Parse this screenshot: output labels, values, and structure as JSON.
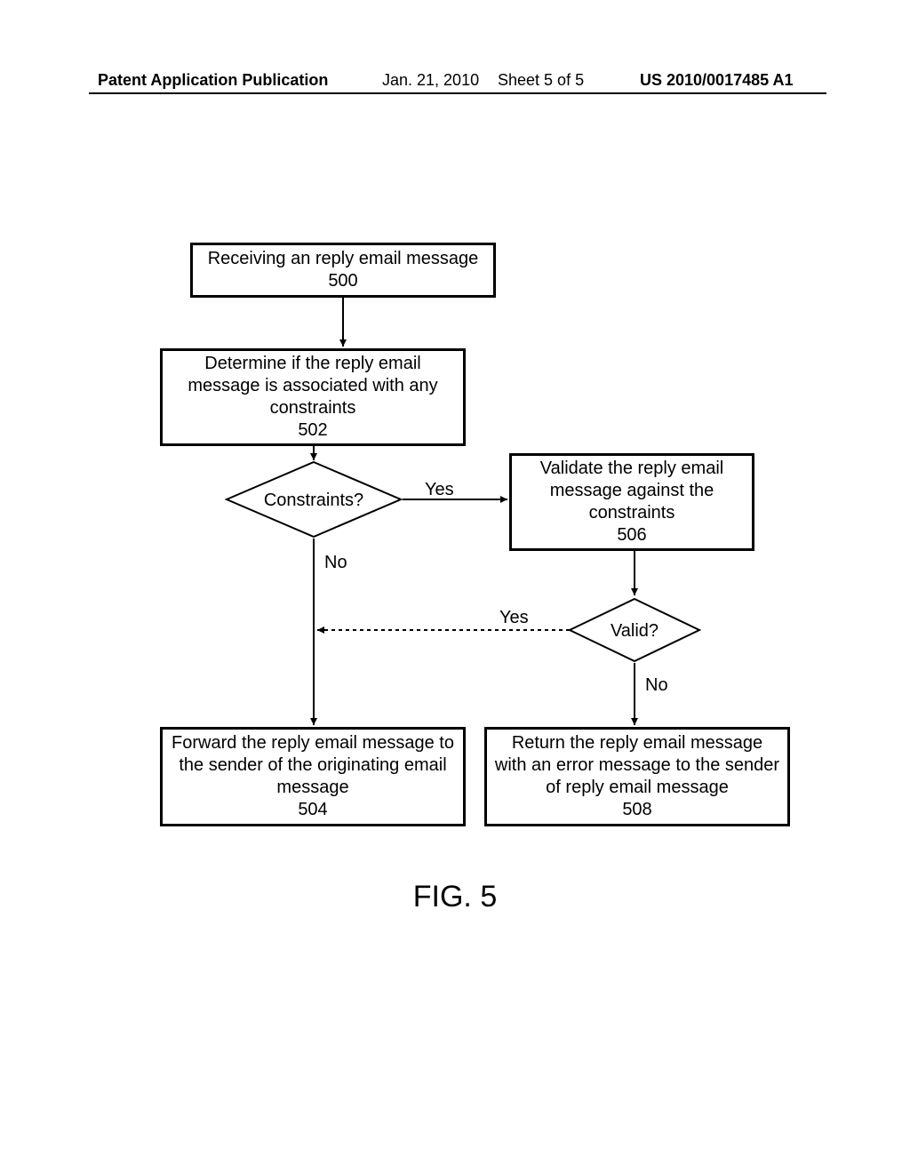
{
  "header": {
    "left": "Patent Application Publication",
    "date": "Jan. 21, 2010",
    "sheet": "Sheet 5 of 5",
    "pub": "US 2010/0017485 A1"
  },
  "boxes": {
    "b500": {
      "text": "Receiving an reply email message",
      "num": "500"
    },
    "b502": {
      "text": "Determine if the reply email message is associated with any constraints",
      "num": "502"
    },
    "b506": {
      "text": "Validate the reply email message against the constraints",
      "num": "506"
    },
    "b504": {
      "text": "Forward the reply email message to the sender of the originating email message",
      "num": "504"
    },
    "b508": {
      "text": "Return the reply email message with an error message to the sender of reply email message",
      "num": "508"
    }
  },
  "decisions": {
    "d_constraints": "Constraints?",
    "d_valid": "Valid?"
  },
  "labels": {
    "yes": "Yes",
    "no": "No"
  },
  "figure": "FIG. 5"
}
